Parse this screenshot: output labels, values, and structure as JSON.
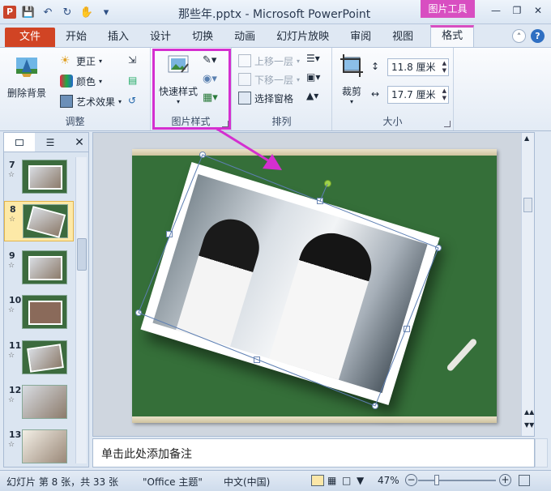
{
  "titlebar": {
    "app_icon": "P",
    "title": "那些年.pptx - Microsoft PowerPoint",
    "context_tab_header": "图片工具"
  },
  "tabs": {
    "file": "文件",
    "items": [
      "开始",
      "插入",
      "设计",
      "切换",
      "动画",
      "幻灯片放映",
      "审阅",
      "视图"
    ],
    "active": "格式"
  },
  "ribbon": {
    "adjust": {
      "label": "调整",
      "remove_bg": "删除背景",
      "corrections": "更正",
      "color": "颜色",
      "artistic": "艺术效果"
    },
    "picture_styles": {
      "label": "图片样式",
      "quick_styles": "快速样式"
    },
    "arrange": {
      "label": "排列",
      "bring_forward": "上移一层",
      "send_backward": "下移一层",
      "selection_pane": "选择窗格"
    },
    "size": {
      "label": "大小",
      "crop": "裁剪",
      "height_value": "11.8 厘米",
      "width_value": "17.7 厘米"
    }
  },
  "slides": [
    {
      "num": "7"
    },
    {
      "num": "8"
    },
    {
      "num": "9"
    },
    {
      "num": "10"
    },
    {
      "num": "11"
    },
    {
      "num": "12"
    },
    {
      "num": "13"
    }
  ],
  "notes": {
    "placeholder": "单击此处添加备注"
  },
  "statusbar": {
    "slide_info": "幻灯片 第 8 张，共 33 张",
    "theme": "\"Office 主题\"",
    "language": "中文(中国)",
    "zoom": "47%"
  },
  "colors": {
    "accent": "#d84ec1",
    "file_tab": "#d14424",
    "slide_bg": "#356f39",
    "highlight": "#d42fd0"
  }
}
